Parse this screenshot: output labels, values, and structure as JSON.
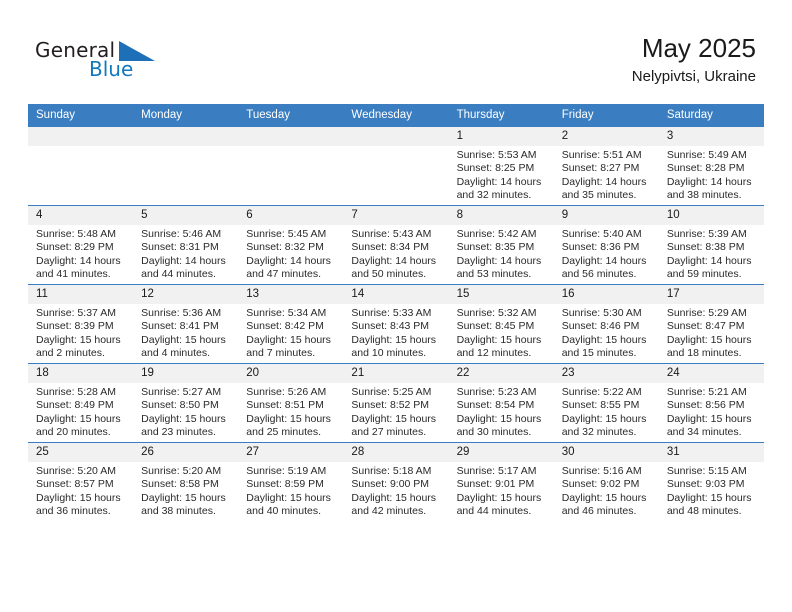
{
  "brand": {
    "name_top": "General",
    "name_bottom": "Blue",
    "triangle_color": "#1d6fb7",
    "blue_text_color": "#1278be"
  },
  "header": {
    "month_title": "May 2025",
    "location": "Nelypivtsi, Ukraine"
  },
  "theme": {
    "header_blue": "#3a7dc0",
    "daynum_gray": "#f1f1f1"
  },
  "weekday_headers": [
    "Sunday",
    "Monday",
    "Tuesday",
    "Wednesday",
    "Thursday",
    "Friday",
    "Saturday"
  ],
  "labels": {
    "sunrise_prefix": "Sunrise:",
    "sunset_prefix": "Sunset:",
    "daylight_prefix": "Daylight:"
  },
  "weeks": [
    [
      {
        "empty": true
      },
      {
        "empty": true
      },
      {
        "empty": true
      },
      {
        "empty": true
      },
      {
        "day": "1",
        "sunrise": "Sunrise: 5:53 AM",
        "sunset": "Sunset: 8:25 PM",
        "daylight_1": "Daylight: 14 hours",
        "daylight_2": "and 32 minutes."
      },
      {
        "day": "2",
        "sunrise": "Sunrise: 5:51 AM",
        "sunset": "Sunset: 8:27 PM",
        "daylight_1": "Daylight: 14 hours",
        "daylight_2": "and 35 minutes."
      },
      {
        "day": "3",
        "sunrise": "Sunrise: 5:49 AM",
        "sunset": "Sunset: 8:28 PM",
        "daylight_1": "Daylight: 14 hours",
        "daylight_2": "and 38 minutes."
      }
    ],
    [
      {
        "day": "4",
        "sunrise": "Sunrise: 5:48 AM",
        "sunset": "Sunset: 8:29 PM",
        "daylight_1": "Daylight: 14 hours",
        "daylight_2": "and 41 minutes."
      },
      {
        "day": "5",
        "sunrise": "Sunrise: 5:46 AM",
        "sunset": "Sunset: 8:31 PM",
        "daylight_1": "Daylight: 14 hours",
        "daylight_2": "and 44 minutes."
      },
      {
        "day": "6",
        "sunrise": "Sunrise: 5:45 AM",
        "sunset": "Sunset: 8:32 PM",
        "daylight_1": "Daylight: 14 hours",
        "daylight_2": "and 47 minutes."
      },
      {
        "day": "7",
        "sunrise": "Sunrise: 5:43 AM",
        "sunset": "Sunset: 8:34 PM",
        "daylight_1": "Daylight: 14 hours",
        "daylight_2": "and 50 minutes."
      },
      {
        "day": "8",
        "sunrise": "Sunrise: 5:42 AM",
        "sunset": "Sunset: 8:35 PM",
        "daylight_1": "Daylight: 14 hours",
        "daylight_2": "and 53 minutes."
      },
      {
        "day": "9",
        "sunrise": "Sunrise: 5:40 AM",
        "sunset": "Sunset: 8:36 PM",
        "daylight_1": "Daylight: 14 hours",
        "daylight_2": "and 56 minutes."
      },
      {
        "day": "10",
        "sunrise": "Sunrise: 5:39 AM",
        "sunset": "Sunset: 8:38 PM",
        "daylight_1": "Daylight: 14 hours",
        "daylight_2": "and 59 minutes."
      }
    ],
    [
      {
        "day": "11",
        "sunrise": "Sunrise: 5:37 AM",
        "sunset": "Sunset: 8:39 PM",
        "daylight_1": "Daylight: 15 hours",
        "daylight_2": "and 2 minutes."
      },
      {
        "day": "12",
        "sunrise": "Sunrise: 5:36 AM",
        "sunset": "Sunset: 8:41 PM",
        "daylight_1": "Daylight: 15 hours",
        "daylight_2": "and 4 minutes."
      },
      {
        "day": "13",
        "sunrise": "Sunrise: 5:34 AM",
        "sunset": "Sunset: 8:42 PM",
        "daylight_1": "Daylight: 15 hours",
        "daylight_2": "and 7 minutes."
      },
      {
        "day": "14",
        "sunrise": "Sunrise: 5:33 AM",
        "sunset": "Sunset: 8:43 PM",
        "daylight_1": "Daylight: 15 hours",
        "daylight_2": "and 10 minutes."
      },
      {
        "day": "15",
        "sunrise": "Sunrise: 5:32 AM",
        "sunset": "Sunset: 8:45 PM",
        "daylight_1": "Daylight: 15 hours",
        "daylight_2": "and 12 minutes."
      },
      {
        "day": "16",
        "sunrise": "Sunrise: 5:30 AM",
        "sunset": "Sunset: 8:46 PM",
        "daylight_1": "Daylight: 15 hours",
        "daylight_2": "and 15 minutes."
      },
      {
        "day": "17",
        "sunrise": "Sunrise: 5:29 AM",
        "sunset": "Sunset: 8:47 PM",
        "daylight_1": "Daylight: 15 hours",
        "daylight_2": "and 18 minutes."
      }
    ],
    [
      {
        "day": "18",
        "sunrise": "Sunrise: 5:28 AM",
        "sunset": "Sunset: 8:49 PM",
        "daylight_1": "Daylight: 15 hours",
        "daylight_2": "and 20 minutes."
      },
      {
        "day": "19",
        "sunrise": "Sunrise: 5:27 AM",
        "sunset": "Sunset: 8:50 PM",
        "daylight_1": "Daylight: 15 hours",
        "daylight_2": "and 23 minutes."
      },
      {
        "day": "20",
        "sunrise": "Sunrise: 5:26 AM",
        "sunset": "Sunset: 8:51 PM",
        "daylight_1": "Daylight: 15 hours",
        "daylight_2": "and 25 minutes."
      },
      {
        "day": "21",
        "sunrise": "Sunrise: 5:25 AM",
        "sunset": "Sunset: 8:52 PM",
        "daylight_1": "Daylight: 15 hours",
        "daylight_2": "and 27 minutes."
      },
      {
        "day": "22",
        "sunrise": "Sunrise: 5:23 AM",
        "sunset": "Sunset: 8:54 PM",
        "daylight_1": "Daylight: 15 hours",
        "daylight_2": "and 30 minutes."
      },
      {
        "day": "23",
        "sunrise": "Sunrise: 5:22 AM",
        "sunset": "Sunset: 8:55 PM",
        "daylight_1": "Daylight: 15 hours",
        "daylight_2": "and 32 minutes."
      },
      {
        "day": "24",
        "sunrise": "Sunrise: 5:21 AM",
        "sunset": "Sunset: 8:56 PM",
        "daylight_1": "Daylight: 15 hours",
        "daylight_2": "and 34 minutes."
      }
    ],
    [
      {
        "day": "25",
        "sunrise": "Sunrise: 5:20 AM",
        "sunset": "Sunset: 8:57 PM",
        "daylight_1": "Daylight: 15 hours",
        "daylight_2": "and 36 minutes."
      },
      {
        "day": "26",
        "sunrise": "Sunrise: 5:20 AM",
        "sunset": "Sunset: 8:58 PM",
        "daylight_1": "Daylight: 15 hours",
        "daylight_2": "and 38 minutes."
      },
      {
        "day": "27",
        "sunrise": "Sunrise: 5:19 AM",
        "sunset": "Sunset: 8:59 PM",
        "daylight_1": "Daylight: 15 hours",
        "daylight_2": "and 40 minutes."
      },
      {
        "day": "28",
        "sunrise": "Sunrise: 5:18 AM",
        "sunset": "Sunset: 9:00 PM",
        "daylight_1": "Daylight: 15 hours",
        "daylight_2": "and 42 minutes."
      },
      {
        "day": "29",
        "sunrise": "Sunrise: 5:17 AM",
        "sunset": "Sunset: 9:01 PM",
        "daylight_1": "Daylight: 15 hours",
        "daylight_2": "and 44 minutes."
      },
      {
        "day": "30",
        "sunrise": "Sunrise: 5:16 AM",
        "sunset": "Sunset: 9:02 PM",
        "daylight_1": "Daylight: 15 hours",
        "daylight_2": "and 46 minutes."
      },
      {
        "day": "31",
        "sunrise": "Sunrise: 5:15 AM",
        "sunset": "Sunset: 9:03 PM",
        "daylight_1": "Daylight: 15 hours",
        "daylight_2": "and 48 minutes."
      }
    ]
  ]
}
